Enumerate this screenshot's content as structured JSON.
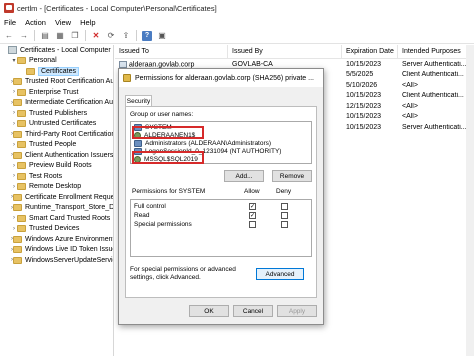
{
  "window": {
    "title": "certlm - [Certificates - Local Computer\\Personal\\Certificates]"
  },
  "menu": [
    "File",
    "Action",
    "View",
    "Help"
  ],
  "tree": {
    "items": [
      {
        "label": "Certificates - Local Computer",
        "level": 0,
        "icon": "computer-icon",
        "arrow": ""
      },
      {
        "label": "Personal",
        "level": 1,
        "icon": "folder-icon",
        "arrow": "▾"
      },
      {
        "label": "Certificates",
        "level": 2,
        "icon": "folder-icon",
        "arrow": "",
        "selected": true
      },
      {
        "label": "Trusted Root Certification Au",
        "level": 1,
        "icon": "folder-icon",
        "arrow": "›"
      },
      {
        "label": "Enterprise Trust",
        "level": 1,
        "icon": "folder-icon",
        "arrow": "›"
      },
      {
        "label": "Intermediate Certification Au",
        "level": 1,
        "icon": "folder-icon",
        "arrow": "›"
      },
      {
        "label": "Trusted Publishers",
        "level": 1,
        "icon": "folder-icon",
        "arrow": "›"
      },
      {
        "label": "Untrusted Certificates",
        "level": 1,
        "icon": "folder-icon",
        "arrow": "›"
      },
      {
        "label": "Third-Party Root Certification",
        "level": 1,
        "icon": "folder-icon",
        "arrow": "›"
      },
      {
        "label": "Trusted People",
        "level": 1,
        "icon": "folder-icon",
        "arrow": "›"
      },
      {
        "label": "Client Authentication Issuers",
        "level": 1,
        "icon": "folder-icon",
        "arrow": "›"
      },
      {
        "label": "Preview Build Roots",
        "level": 1,
        "icon": "folder-icon",
        "arrow": "›"
      },
      {
        "label": "Test Roots",
        "level": 1,
        "icon": "folder-icon",
        "arrow": "›"
      },
      {
        "label": "Remote Desktop",
        "level": 1,
        "icon": "folder-icon",
        "arrow": "›"
      },
      {
        "label": "Certificate Enrollment Reque",
        "level": 1,
        "icon": "folder-icon",
        "arrow": "›"
      },
      {
        "label": "Runtime_Transport_Store_D26",
        "level": 1,
        "icon": "folder-icon",
        "arrow": "›"
      },
      {
        "label": "Smart Card Trusted Roots",
        "level": 1,
        "icon": "folder-icon",
        "arrow": "›"
      },
      {
        "label": "Trusted Devices",
        "level": 1,
        "icon": "folder-icon",
        "arrow": "›"
      },
      {
        "label": "Windows Azure Environment",
        "level": 1,
        "icon": "folder-icon",
        "arrow": "›"
      },
      {
        "label": "Windows Live ID Token Issuer",
        "level": 1,
        "icon": "folder-icon",
        "arrow": "›"
      },
      {
        "label": "WindowsServerUpdateService",
        "level": 1,
        "icon": "folder-icon",
        "arrow": "›"
      }
    ]
  },
  "list": {
    "columns": [
      "Issued To",
      "Issued By",
      "Expiration Date",
      "Intended Purposes"
    ],
    "rows": [
      [
        "alderaan.govlab.corp",
        "GOVLAB-CA",
        "10/15/2023",
        "Server Authenticati..."
      ],
      [
        "",
        "",
        "5/5/2025",
        "Client Authenticati..."
      ],
      [
        "",
        "",
        "5/10/2026",
        "<All>"
      ],
      [
        "",
        "",
        "10/15/2023",
        "Client Authenticati..."
      ],
      [
        "",
        "",
        "12/15/2023",
        "<All>"
      ],
      [
        "",
        "",
        "10/15/2023",
        "<All>"
      ],
      [
        "",
        "",
        "10/15/2023",
        "Server Authenticati..."
      ]
    ]
  },
  "dialog": {
    "title": "Permissions for alderaan.govlab.corp (SHA256) private ...",
    "tab": "Security",
    "group_label": "Group or user names:",
    "users": [
      {
        "name": "SYSTEM",
        "icon": "group-icon"
      },
      {
        "name": "ALDERAANEN1$",
        "icon": "user-icon"
      },
      {
        "name": "Administrators (ALDERAAN\\Administrators)",
        "icon": "group-icon"
      },
      {
        "name": "LogonSessionId_0_1231094 (NT AUTHORITY)",
        "icon": "group-icon"
      },
      {
        "name": "MSSQL$SQL2019",
        "icon": "user-icon"
      }
    ],
    "add_label": "Add...",
    "remove_label": "Remove",
    "perm_label": "Permissions for SYSTEM",
    "allow_label": "Allow",
    "deny_label": "Deny",
    "permissions": [
      {
        "name": "Full control",
        "allow": true,
        "deny": false
      },
      {
        "name": "Read",
        "allow": true,
        "deny": false
      },
      {
        "name": "Special permissions",
        "allow": false,
        "deny": false
      }
    ],
    "advanced_text": "For special permissions or advanced settings, click Advanced.",
    "advanced_label": "Advanced",
    "ok_label": "OK",
    "cancel_label": "Cancel",
    "apply_label": "Apply"
  },
  "colors": {
    "highlight_box": "#d62a2a",
    "selection": "#cde8ff"
  }
}
